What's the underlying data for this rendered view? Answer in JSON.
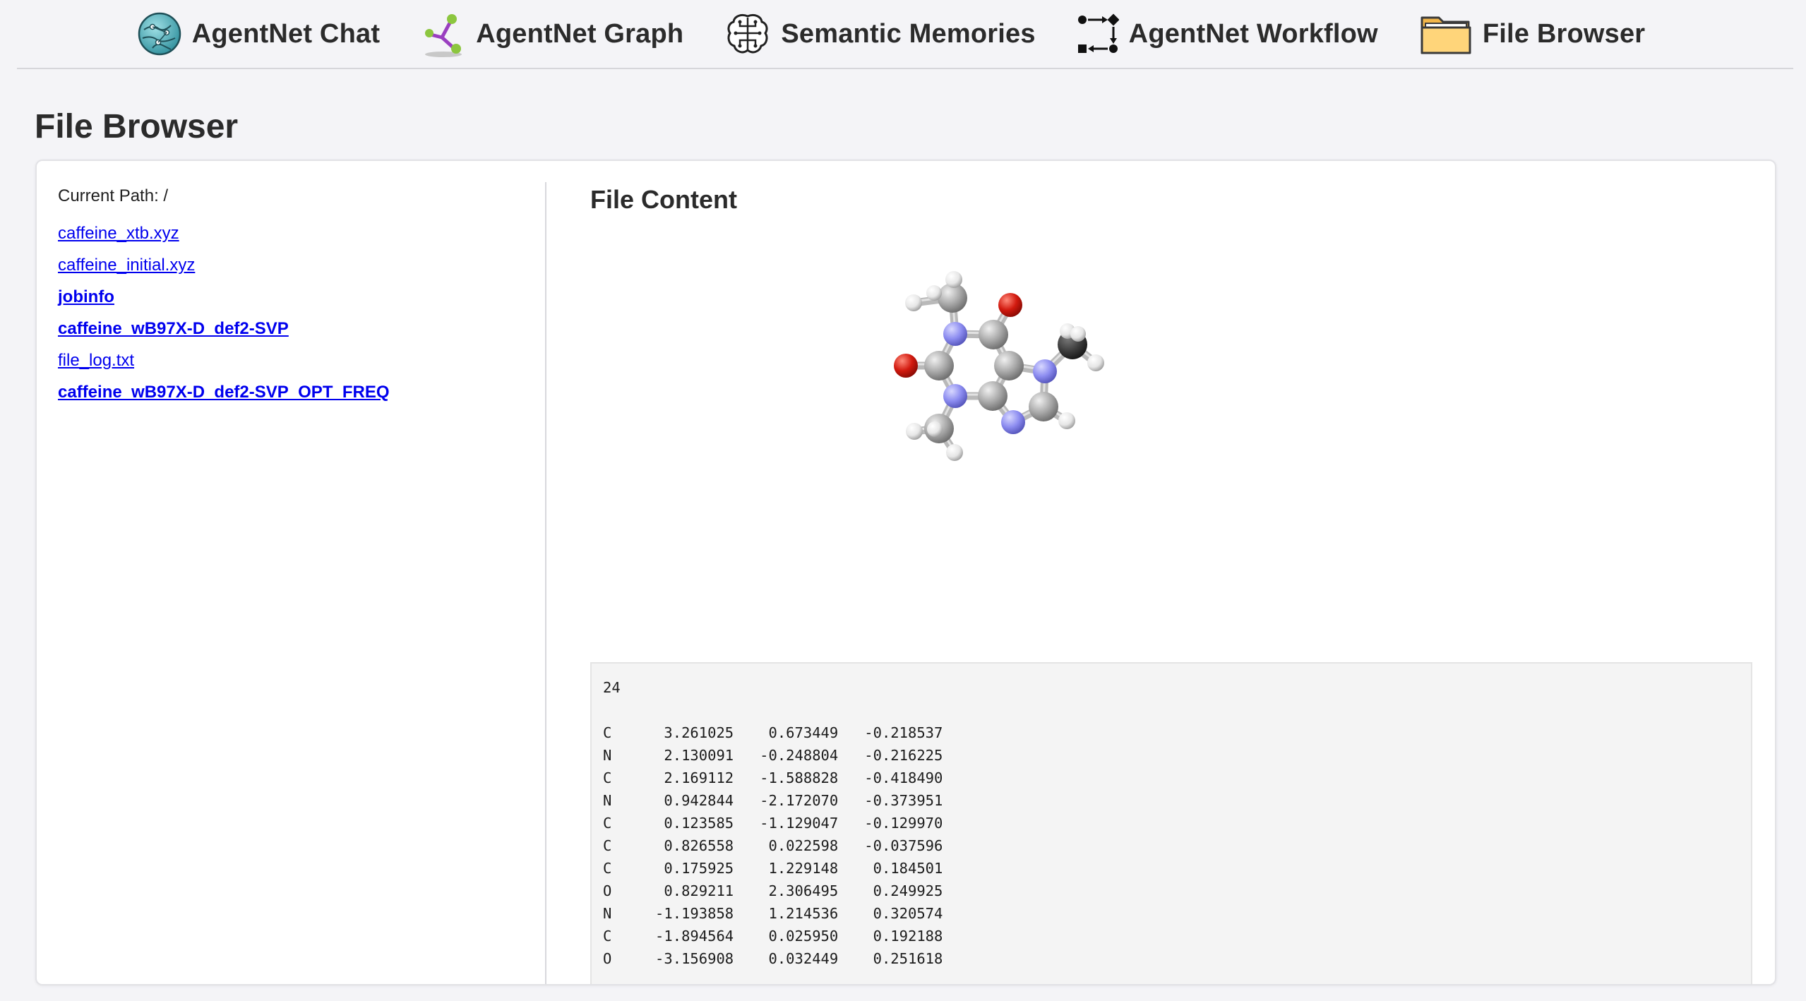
{
  "nav": {
    "items": [
      {
        "label": "AgentNet Chat",
        "icon": "globe-network-icon"
      },
      {
        "label": "AgentNet Graph",
        "icon": "graph-nodes-icon"
      },
      {
        "label": "Semantic Memories",
        "icon": "brain-circuit-icon"
      },
      {
        "label": "AgentNet Workflow",
        "icon": "workflow-arrows-icon"
      },
      {
        "label": "File Browser",
        "icon": "folder-icon"
      }
    ]
  },
  "page": {
    "title": "File Browser"
  },
  "browser": {
    "current_path_label": "Current Path: /",
    "files": [
      {
        "name": "caffeine_xtb.xyz",
        "type": "file"
      },
      {
        "name": "caffeine_initial.xyz",
        "type": "file"
      },
      {
        "name": "jobinfo",
        "type": "directory"
      },
      {
        "name": "caffeine_wB97X-D_def2-SVP",
        "type": "directory"
      },
      {
        "name": "file_log.txt",
        "type": "file"
      },
      {
        "name": "caffeine_wB97X-D_def2-SVP_OPT_FREQ",
        "type": "directory"
      }
    ]
  },
  "content": {
    "title": "File Content",
    "molecule_viewer": "caffeine-3d-molecule",
    "file_text": "24\n\nC      3.261025    0.673449   -0.218537\nN      2.130091   -0.248804   -0.216225\nC      2.169112   -1.588828   -0.418490\nN      0.942844   -2.172070   -0.373951\nC      0.123585   -1.129047   -0.129970\nC      0.826558    0.022598   -0.037596\nC      0.175925    1.229148    0.184501\nO      0.829211    2.306495    0.249925\nN     -1.193858    1.214536    0.320574\nC     -1.894564    0.025950    0.192188\nO     -3.156908    0.032449    0.251618"
  },
  "colors": {
    "background": "#f4f4f7",
    "link": "#0000ee",
    "carbon": "#a9a9a9",
    "nitrogen": "#8c8cf0",
    "oxygen": "#d21a0f",
    "hydrogen": "#e6e6e6"
  }
}
